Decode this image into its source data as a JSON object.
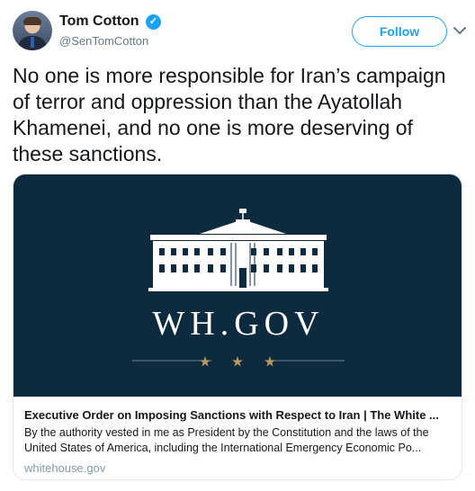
{
  "author": {
    "name": "Tom Cotton",
    "handle": "@SenTomCotton",
    "verified_glyph": "✓"
  },
  "actions": {
    "follow_label": "Follow",
    "more_icon": "chevron-down-icon"
  },
  "tweet": {
    "text": "No one is more responsible for Iran’s campaign of terror and oppression than the Ayatollah Khamenei, and no one is more deserving of these sanctions."
  },
  "card": {
    "image_text": "WH.GOV",
    "title": "Executive Order on Imposing Sanctions with Respect to Iran | The White ...",
    "description": "By the authority vested in me as President by the Constitution and the laws of the United States of America, including the International Emergency Economic Po...",
    "domain": "whitehouse.gov"
  },
  "colors": {
    "accent": "#1da1f2",
    "card_background": "#0e2a3f",
    "stars": "#b89a5e"
  }
}
